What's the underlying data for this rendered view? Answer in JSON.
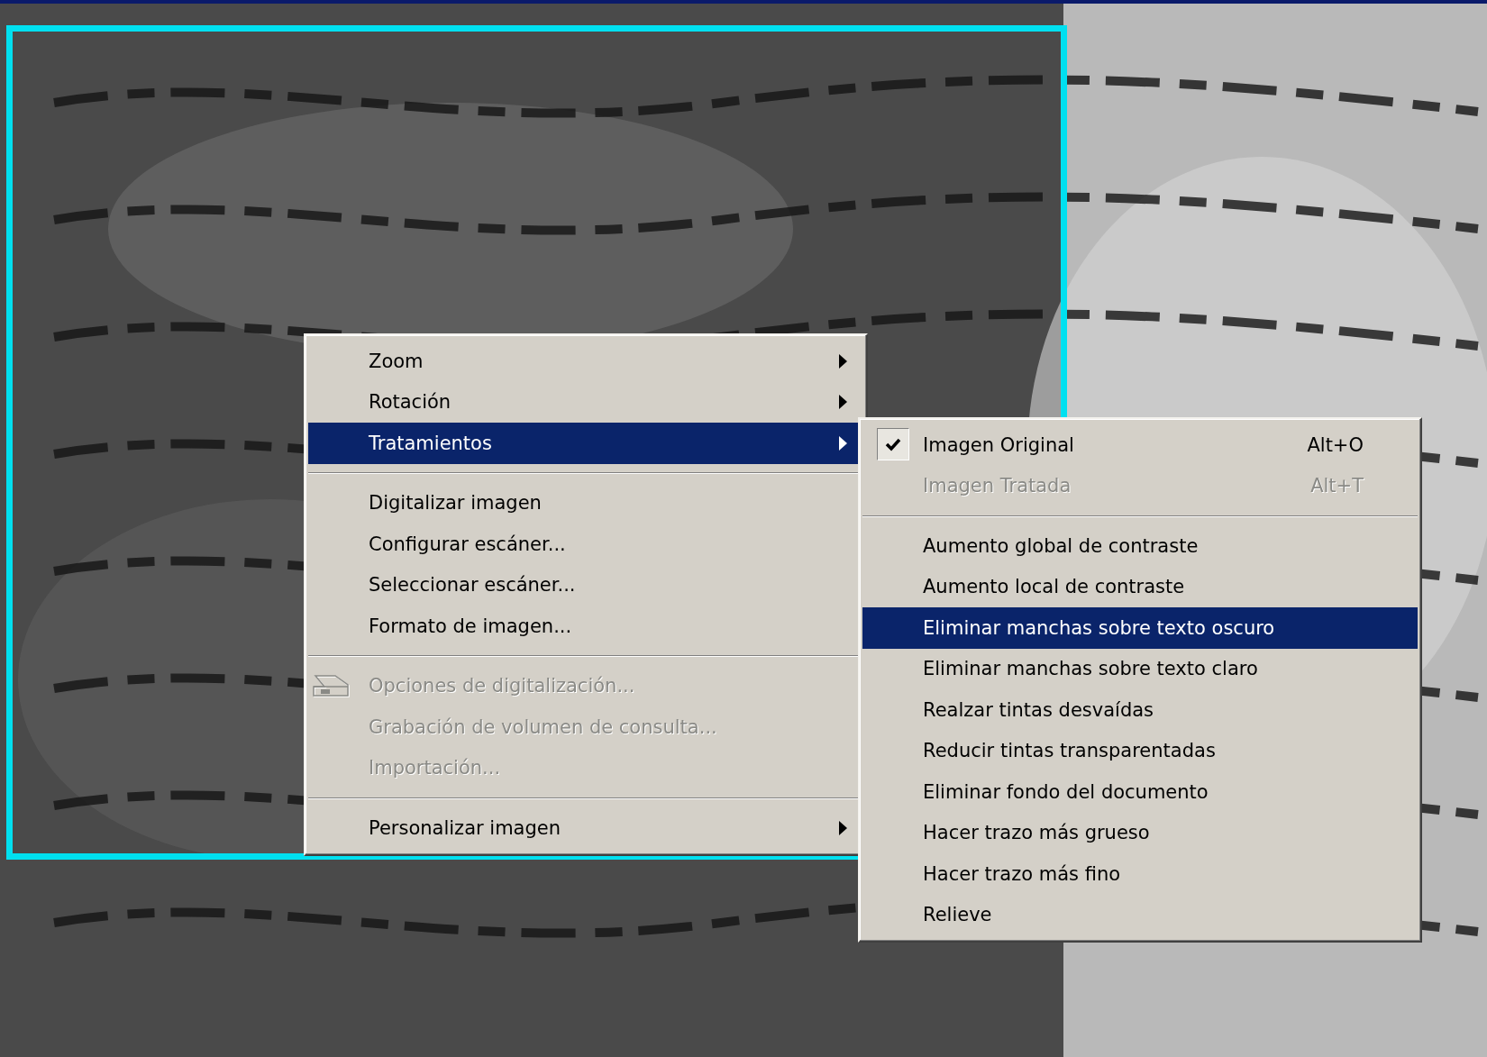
{
  "context_menu": {
    "items": [
      {
        "kind": "item",
        "label": "Zoom",
        "submenu": true,
        "selected": false,
        "disabled": false
      },
      {
        "kind": "item",
        "label": "Rotación",
        "submenu": true,
        "selected": false,
        "disabled": false
      },
      {
        "kind": "item",
        "label": "Tratamientos",
        "submenu": true,
        "selected": true,
        "disabled": false
      },
      {
        "kind": "separator"
      },
      {
        "kind": "item",
        "label": "Digitalizar imagen",
        "submenu": false,
        "selected": false,
        "disabled": false
      },
      {
        "kind": "item",
        "label": "Configurar escáner...",
        "submenu": false,
        "selected": false,
        "disabled": false
      },
      {
        "kind": "item",
        "label": "Seleccionar escáner...",
        "submenu": false,
        "selected": false,
        "disabled": false
      },
      {
        "kind": "item",
        "label": "Formato de imagen...",
        "submenu": false,
        "selected": false,
        "disabled": false
      },
      {
        "kind": "separator"
      },
      {
        "kind": "item",
        "label": "Opciones de digitalización...",
        "submenu": false,
        "selected": false,
        "disabled": true,
        "has_icon": true
      },
      {
        "kind": "item",
        "label": "Grabación de volumen de consulta...",
        "submenu": false,
        "selected": false,
        "disabled": true
      },
      {
        "kind": "item",
        "label": "Importación...",
        "submenu": false,
        "selected": false,
        "disabled": true
      },
      {
        "kind": "separator"
      },
      {
        "kind": "item",
        "label": "Personalizar imagen",
        "submenu": true,
        "selected": false,
        "disabled": false
      }
    ]
  },
  "submenu": {
    "items": [
      {
        "kind": "item",
        "label": "Imagen Original",
        "shortcut": "Alt+O",
        "checked": true,
        "selected": false,
        "disabled": false
      },
      {
        "kind": "item",
        "label": "Imagen Tratada",
        "shortcut": "Alt+T",
        "checked": false,
        "selected": false,
        "disabled": true
      },
      {
        "kind": "separator"
      },
      {
        "kind": "item",
        "label": "Aumento global de contraste",
        "checked": false,
        "selected": false,
        "disabled": false
      },
      {
        "kind": "item",
        "label": "Aumento local de contraste",
        "checked": false,
        "selected": false,
        "disabled": false
      },
      {
        "kind": "item",
        "label": "Eliminar manchas sobre texto oscuro",
        "checked": false,
        "selected": true,
        "disabled": false
      },
      {
        "kind": "item",
        "label": "Eliminar manchas sobre texto claro",
        "checked": false,
        "selected": false,
        "disabled": false
      },
      {
        "kind": "item",
        "label": "Realzar tintas desvaídas",
        "checked": false,
        "selected": false,
        "disabled": false
      },
      {
        "kind": "item",
        "label": "Reducir tintas transparentadas",
        "checked": false,
        "selected": false,
        "disabled": false
      },
      {
        "kind": "item",
        "label": "Eliminar fondo del documento",
        "checked": false,
        "selected": false,
        "disabled": false
      },
      {
        "kind": "item",
        "label": "Hacer trazo más grueso",
        "checked": false,
        "selected": false,
        "disabled": false
      },
      {
        "kind": "item",
        "label": "Hacer trazo más fino",
        "checked": false,
        "selected": false,
        "disabled": false
      },
      {
        "kind": "item",
        "label": "Relieve",
        "checked": false,
        "selected": false,
        "disabled": false
      }
    ]
  }
}
